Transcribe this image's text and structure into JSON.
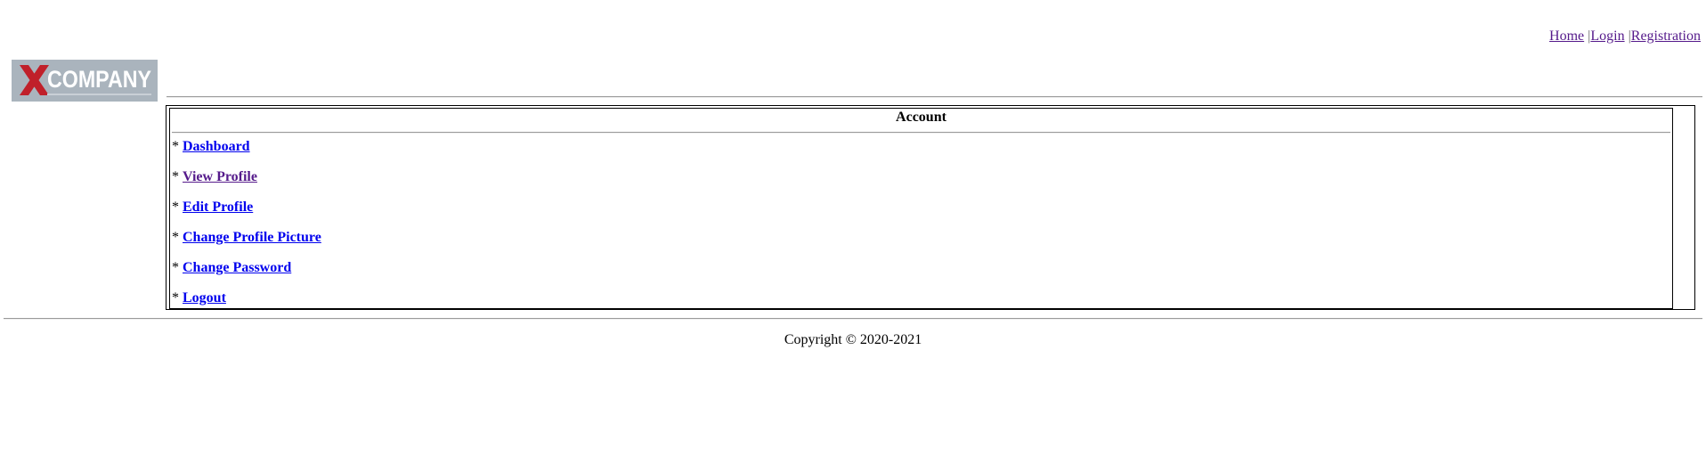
{
  "logo": {
    "mark": "X",
    "text": "COMPANY",
    "mark_color": "#c0202a",
    "text_color": "#ffffff",
    "background": "#aab4bd"
  },
  "topnav": {
    "items": [
      {
        "label": "Home"
      },
      {
        "label": "Login"
      },
      {
        "label": "Registration"
      }
    ],
    "separator": "|"
  },
  "account": {
    "title": "Account",
    "bullet": "* ",
    "menu": [
      {
        "label": "Dashboard"
      },
      {
        "label": "View Profile"
      },
      {
        "label": "Edit Profile"
      },
      {
        "label": "Change Profile Picture"
      },
      {
        "label": "Change Password"
      },
      {
        "label": "Logout"
      }
    ]
  },
  "footer": {
    "copyright": "Copyright © 2020-2021"
  },
  "colors": {
    "link": "#0000ee",
    "visited_link": "#551a8b"
  }
}
